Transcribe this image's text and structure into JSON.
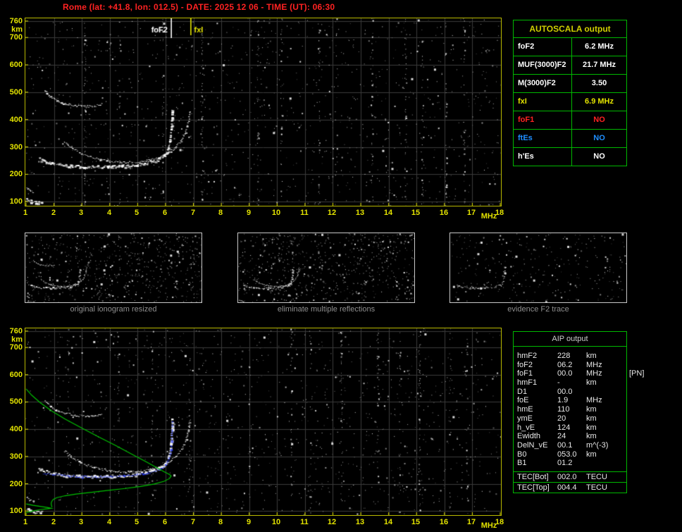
{
  "title": "Rome (lat: +41.8, lon: 012.5) - DATE: 2025 12 06 - TIME (UT): 06:30",
  "colors": {
    "title_red": "#ff2222",
    "frame_yellow": "#b9b900",
    "axis_yellow": "#e3e300",
    "grid_gray": "#3a3a3a",
    "echo_white": "#ffffff",
    "profile_green": "#00c000",
    "fitted_blue": "#2438ff",
    "table_green": "#00b800",
    "caption_gray": "#8f8f8f",
    "value_blue": "#1f8fff"
  },
  "autoscala_table": {
    "title": "AUTOSCALA output",
    "rows": [
      {
        "label": "foF2",
        "value": "6.2 MHz",
        "color": "#ffffff"
      },
      {
        "label": "MUF(3000)F2",
        "value": "21.7 MHz",
        "color": "#ffffff"
      },
      {
        "label": "M(3000)F2",
        "value": "3.50",
        "color": "#ffffff"
      },
      {
        "label": "fxI",
        "value": "6.9 MHz",
        "color": "#e3e300"
      },
      {
        "label": "foF1",
        "value": "NO",
        "color": "#ff2222"
      },
      {
        "label": "ftEs",
        "value": "NO",
        "color": "#1f8fff"
      },
      {
        "label": "h'Es",
        "value": "NO",
        "color": "#ffffff"
      }
    ]
  },
  "aip_table": {
    "title": "AIP output",
    "rows": [
      {
        "name": "hmF2",
        "value": "228",
        "unit": "km",
        "note": ""
      },
      {
        "name": "foF2",
        "value": "06.2",
        "unit": "MHz",
        "note": ""
      },
      {
        "name": "foF1",
        "value": "00.0",
        "unit": "MHz",
        "note": "[PN]"
      },
      {
        "name": "hmF1",
        "value": "-",
        "unit": "km",
        "note": ""
      },
      {
        "name": "D1",
        "value": "00.0",
        "unit": "",
        "note": ""
      },
      {
        "name": "foE",
        "value": "1.9",
        "unit": "MHz",
        "note": ""
      },
      {
        "name": "hmE",
        "value": "110",
        "unit": "km",
        "note": ""
      },
      {
        "name": "ymE",
        "value": "20",
        "unit": "km",
        "note": ""
      },
      {
        "name": "h_vE",
        "value": "124",
        "unit": "km",
        "note": ""
      },
      {
        "name": "Ewidth",
        "value": "24",
        "unit": "km",
        "note": ""
      },
      {
        "name": "DelN_vE",
        "value": "00.1",
        "unit": "m^(-3)",
        "note": ""
      },
      {
        "name": "B0",
        "value": "053.0",
        "unit": "km",
        "note": ""
      },
      {
        "name": "B1",
        "value": "01.2",
        "unit": "",
        "note": ""
      }
    ],
    "tec_rows": [
      {
        "name": "TEC[Bot]",
        "value": "002.0",
        "unit": "TECU"
      },
      {
        "name": "TEC[Top]",
        "value": "004.4",
        "unit": "TECU"
      }
    ]
  },
  "thumbnails": [
    {
      "caption": "original ionogram resized",
      "series": [
        "F2_ordinary",
        "F2_extraordinary",
        "second_hop_multiple",
        "E_echo_low",
        "E_echo_mid"
      ],
      "noise_dots": 620,
      "seed": 77,
      "dim": false
    },
    {
      "caption": "eliminate multiple reflections",
      "series": [
        "F2_ordinary",
        "F2_extraordinary",
        "E_echo_low"
      ],
      "noise_dots": 640,
      "seed": 99,
      "dim": false
    },
    {
      "caption": "evidence F2 trace",
      "series": [
        "F2_ordinary"
      ],
      "noise_dots": 280,
      "seed": 55,
      "dim": true
    }
  ],
  "chart_data": {
    "type": "scatter",
    "x_unit": "MHz",
    "y_unit": "km",
    "xlim": [
      1,
      18
    ],
    "ylim_km": [
      85,
      770
    ],
    "xticks": [
      1,
      2,
      3,
      4,
      5,
      6,
      7,
      8,
      9,
      10,
      11,
      12,
      13,
      14,
      15,
      16,
      17,
      18
    ],
    "yticks": [
      760,
      700,
      600,
      500,
      400,
      300,
      200,
      100
    ],
    "grid": true,
    "autoscaled_values": {
      "foF2_MHz": 6.2,
      "fxI_MHz": 6.9,
      "MUF3000F2_MHz": 21.7,
      "M3000F2": 3.5
    },
    "plots": [
      {
        "id": "scaled-ionogram",
        "markers": [
          {
            "label": "foF2",
            "freq_mhz": 6.2,
            "color": "#ffffff",
            "label_side": "left"
          },
          {
            "label": "fxI",
            "freq_mhz": 6.9,
            "color": "#e3e300",
            "label_side": "right"
          }
        ],
        "series": [
          {
            "trace": "F2_ordinary",
            "color": "#ffffff",
            "thickness": 3
          },
          {
            "trace": "F2_extraordinary",
            "color": "#ffffff",
            "thickness": 2
          },
          {
            "trace": "second_hop_multiple",
            "color": "#ffffff",
            "thickness": 2
          },
          {
            "trace": "E_echo_low",
            "color": "#ffffff",
            "thickness": 3
          },
          {
            "trace": "E_echo_mid",
            "color": "#ffffff",
            "thickness": 2
          }
        ],
        "noise": {
          "seed": 20251206,
          "dots": 1150,
          "streaks_mhz": [
            3.1,
            4.35,
            5.9,
            7.3,
            9.3,
            10.15,
            11.5,
            12.1,
            13.4,
            14.6,
            15.2,
            16.05,
            16.7
          ]
        }
      },
      {
        "id": "aip-ionogram",
        "markers": [],
        "series": [
          {
            "trace": "F2_ordinary",
            "color": "#ffffff",
            "thickness": 3
          },
          {
            "trace": "F2_extraordinary",
            "color": "#ffffff",
            "thickness": 2
          },
          {
            "trace": "second_hop_multiple",
            "color": "#ffffff",
            "thickness": 2
          },
          {
            "trace": "E_echo_low",
            "color": "#ffffff",
            "thickness": 3
          },
          {
            "trace": "E_echo_mid",
            "color": "#ffffff",
            "thickness": 2
          },
          {
            "trace": "fitted_trace",
            "color": "#2438ff",
            "thickness": 2
          },
          {
            "trace": "electron_density_profile",
            "color": "#00c000",
            "line": true
          },
          {
            "trace": "E_layer_profile",
            "color": "#00c000",
            "line": true
          }
        ],
        "noise": {
          "seed": 630,
          "dots": 1150,
          "streaks_mhz": [
            2.5,
            4.3,
            5.5,
            6.85,
            8.2,
            9.0,
            10.5,
            11.2,
            12.3,
            13.6,
            14.4,
            15.1,
            16.2,
            16.8
          ]
        }
      }
    ],
    "traces": {
      "F2_ordinary": {
        "points_mhz_km": [
          [
            1.45,
            258
          ],
          [
            1.7,
            246
          ],
          [
            2.0,
            238
          ],
          [
            2.4,
            233
          ],
          [
            2.9,
            230
          ],
          [
            3.4,
            228
          ],
          [
            3.9,
            229
          ],
          [
            4.4,
            231
          ],
          [
            4.9,
            236
          ],
          [
            5.3,
            243
          ],
          [
            5.7,
            255
          ],
          [
            5.95,
            272
          ],
          [
            6.08,
            296
          ],
          [
            6.15,
            326
          ],
          [
            6.19,
            362
          ],
          [
            6.21,
            400
          ],
          [
            6.22,
            438
          ]
        ]
      },
      "F2_extraordinary": {
        "points_mhz_km": [
          [
            2.35,
            322
          ],
          [
            2.6,
            300
          ],
          [
            2.9,
            281
          ],
          [
            3.2,
            268
          ],
          [
            3.6,
            256
          ],
          [
            4.0,
            248
          ],
          [
            4.5,
            244
          ],
          [
            5.0,
            246
          ],
          [
            5.4,
            252
          ],
          [
            5.8,
            263
          ],
          [
            6.1,
            280
          ],
          [
            6.35,
            300
          ],
          [
            6.55,
            325
          ],
          [
            6.7,
            355
          ],
          [
            6.8,
            392
          ],
          [
            6.86,
            432
          ]
        ]
      },
      "second_hop_multiple": {
        "points_mhz_km": [
          [
            1.65,
            508
          ],
          [
            1.85,
            486
          ],
          [
            2.1,
            470
          ],
          [
            2.4,
            459
          ],
          [
            2.75,
            452
          ],
          [
            3.1,
            449
          ],
          [
            3.45,
            451
          ],
          [
            3.7,
            457
          ]
        ]
      },
      "E_echo_mid": {
        "points_mhz_km": [
          [
            1.0,
            152
          ],
          [
            1.12,
            142
          ],
          [
            1.25,
            135
          ]
        ]
      },
      "E_echo_low": {
        "points_mhz_km": [
          [
            1.0,
            110
          ],
          [
            1.15,
            103
          ],
          [
            1.35,
            98
          ],
          [
            1.55,
            96
          ]
        ]
      },
      "fitted_trace": {
        "points_mhz_km": [
          [
            1.6,
            240
          ],
          [
            2.0,
            234
          ],
          [
            2.5,
            230
          ],
          [
            3.0,
            227
          ],
          [
            3.5,
            226
          ],
          [
            4.0,
            227
          ],
          [
            4.5,
            230
          ],
          [
            5.0,
            235
          ],
          [
            5.4,
            242
          ],
          [
            5.8,
            255
          ],
          [
            6.0,
            271
          ],
          [
            6.1,
            291
          ],
          [
            6.17,
            320
          ],
          [
            6.2,
            353
          ],
          [
            6.22,
            393
          ],
          [
            6.23,
            430
          ]
        ]
      },
      "electron_density_profile": {
        "points_mhz_km": [
          [
            1.0,
            548
          ],
          [
            1.2,
            525
          ],
          [
            1.5,
            498
          ],
          [
            1.9,
            468
          ],
          [
            2.4,
            437
          ],
          [
            3.0,
            404
          ],
          [
            3.6,
            372
          ],
          [
            4.2,
            341
          ],
          [
            4.8,
            308
          ],
          [
            5.3,
            281
          ],
          [
            5.7,
            258
          ],
          [
            5.95,
            244
          ],
          [
            6.1,
            236
          ],
          [
            6.18,
            231
          ],
          [
            6.2,
            228
          ],
          [
            6.14,
            219
          ],
          [
            5.95,
            209
          ],
          [
            5.6,
            199
          ],
          [
            5.1,
            190
          ],
          [
            4.5,
            182
          ],
          [
            3.9,
            175
          ],
          [
            3.3,
            168
          ],
          [
            2.8,
            162
          ],
          [
            2.4,
            156
          ],
          [
            2.1,
            149
          ],
          [
            1.97,
            142
          ],
          [
            1.92,
            135
          ],
          [
            1.9,
            128
          ],
          [
            1.91,
            121
          ],
          [
            1.93,
            114
          ]
        ]
      },
      "E_layer_profile": {
        "points_mhz_km": [
          [
            1.0,
            94
          ],
          [
            1.25,
            100
          ],
          [
            1.5,
            105
          ],
          [
            1.75,
            108
          ],
          [
            1.9,
            110
          ],
          [
            1.75,
            113
          ],
          [
            1.5,
            117
          ],
          [
            1.25,
            121
          ],
          [
            1.0,
            126
          ]
        ]
      }
    }
  }
}
